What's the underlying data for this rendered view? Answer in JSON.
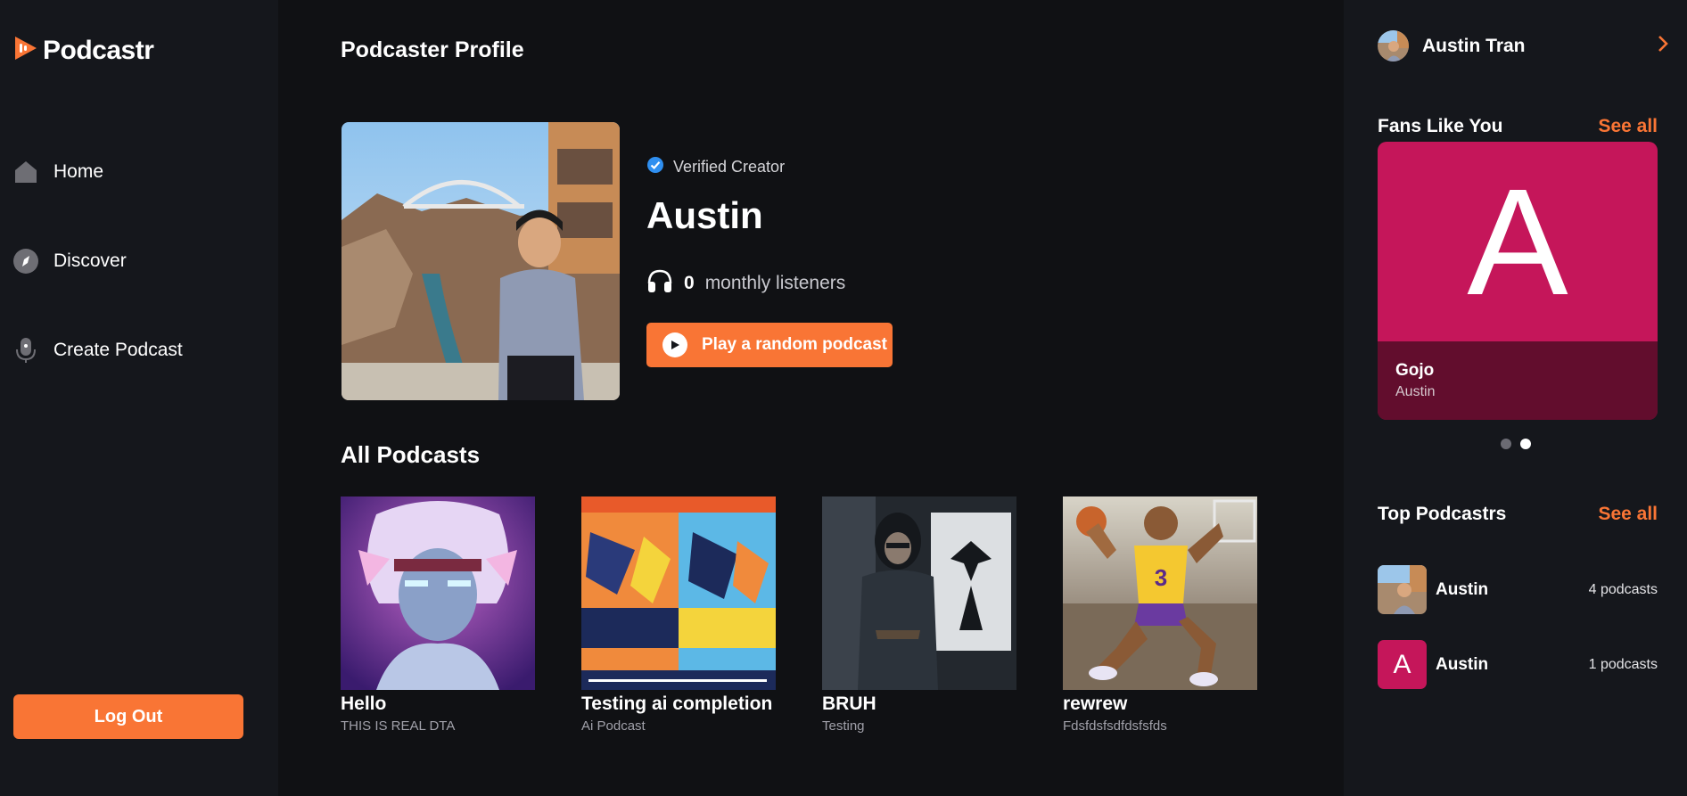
{
  "app": {
    "name": "Podcastr"
  },
  "sidebar": {
    "items": [
      {
        "label": "Home",
        "icon": "home-icon"
      },
      {
        "label": "Discover",
        "icon": "compass-icon"
      },
      {
        "label": "Create Podcast",
        "icon": "microphone-icon"
      }
    ],
    "logout_label": "Log Out"
  },
  "main": {
    "page_title": "Podcaster Profile",
    "profile": {
      "verified_label": "Verified Creator",
      "name": "Austin",
      "listeners_count": "0",
      "listeners_suffix": "monthly listeners",
      "play_button_label": "Play a random podcast"
    },
    "podcasts_title": "All Podcasts",
    "podcasts": [
      {
        "title": "Hello",
        "description": "THIS IS REAL DTA"
      },
      {
        "title": "Testing ai completion",
        "description": "Ai Podcast"
      },
      {
        "title": "BRUH",
        "description": "Testing"
      },
      {
        "title": "rewrew",
        "description": "Fdsfdsfsdfdsfsfds"
      }
    ]
  },
  "right_sidebar": {
    "user_name": "Austin Tran",
    "fans": {
      "title": "Fans Like You",
      "see_all": "See all",
      "card": {
        "letter": "A",
        "name": "Gojo",
        "author": "Austin"
      },
      "carousel_active_index": 1
    },
    "top": {
      "title": "Top Podcastrs",
      "see_all": "See all",
      "items": [
        {
          "name": "Austin",
          "count": "4 podcasts"
        },
        {
          "name": "Austin",
          "letter": "A",
          "count": "1 podcasts"
        }
      ]
    }
  },
  "colors": {
    "accent": "#f97535",
    "background": "#101114",
    "sidebar": "#15171c",
    "fan_card": "#c5165a"
  }
}
